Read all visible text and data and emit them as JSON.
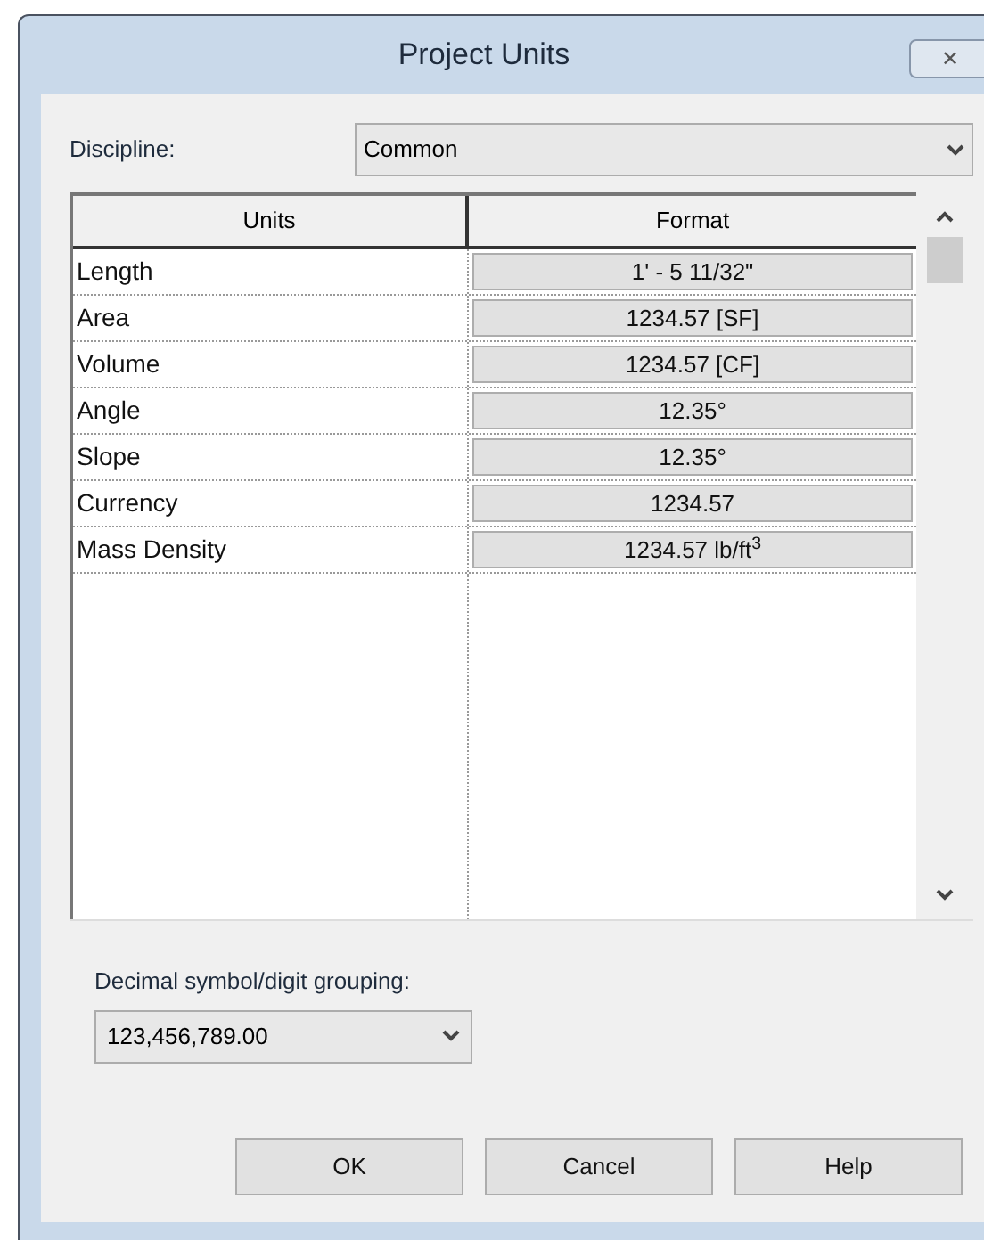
{
  "window": {
    "title": "Project Units",
    "close": "✕"
  },
  "discipline": {
    "label": "Discipline:",
    "value": "Common"
  },
  "table": {
    "columns": [
      "Units",
      "Format"
    ],
    "rows": [
      {
        "unit": "Length",
        "format": "1' - 5 11/32\""
      },
      {
        "unit": "Area",
        "format": "1234.57 [SF]"
      },
      {
        "unit": "Volume",
        "format": "1234.57 [CF]"
      },
      {
        "unit": "Angle",
        "format": "12.35°"
      },
      {
        "unit": "Slope",
        "format": "12.35°"
      },
      {
        "unit": "Currency",
        "format": "1234.57"
      },
      {
        "unit": "Mass Density",
        "format": "1234.57 lb/ft$^{3}$"
      }
    ]
  },
  "grouping": {
    "label": "Decimal symbol/digit grouping:",
    "value": "123,456,789.00"
  },
  "buttons": [
    "OK",
    "Cancel",
    "Help"
  ]
}
